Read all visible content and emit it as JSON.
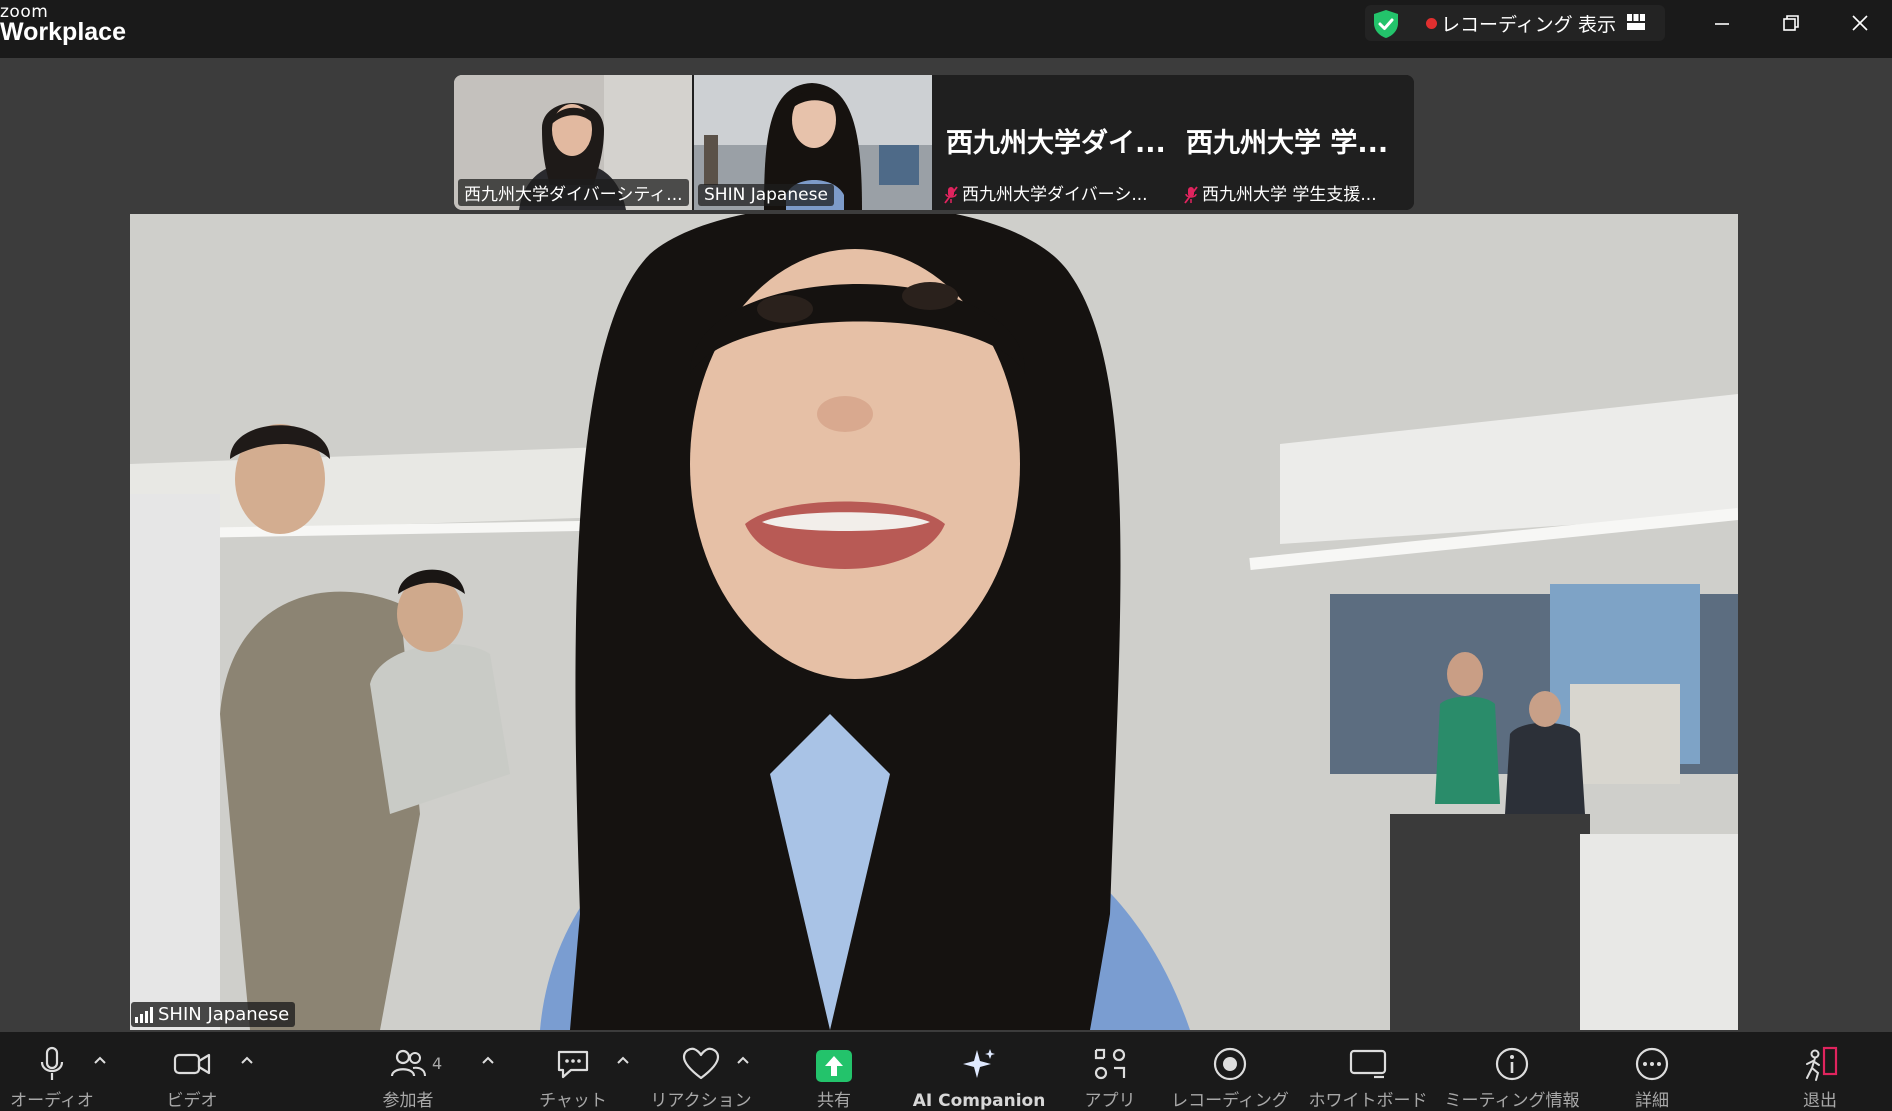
{
  "app": {
    "logo_top": "zoom",
    "logo_bottom": "Workplace"
  },
  "titlebar": {
    "recording_label": "レコーディング",
    "view_label": "表示",
    "colors": {
      "shield": "#23c36b",
      "rec_dot": "#e02f2f"
    }
  },
  "thumbnails": [
    {
      "name": "西九州大学ダイバーシティ...",
      "type": "video",
      "muted": false,
      "active": false
    },
    {
      "name": "SHIN Japanese",
      "type": "video",
      "muted": false,
      "active": true
    },
    {
      "name": "西九州大学ダイバーシ...",
      "big_name": "西九州大学ダイ...",
      "type": "name",
      "muted": true,
      "active": false
    },
    {
      "name": "西九州大学 学生支援...",
      "big_name": "西九州大学 学...",
      "type": "name",
      "muted": true,
      "active": false
    }
  ],
  "main_speaker": {
    "name": "SHIN Japanese"
  },
  "toolbar": {
    "audio": "オーディオ",
    "video": "ビデオ",
    "participants": "参加者",
    "participants_count": "4",
    "chat": "チャット",
    "reactions": "リアクション",
    "share": "共有",
    "ai_companion": "AI Companion",
    "apps": "アプリ",
    "recording": "レコーディング",
    "whiteboard": "ホワイトボード",
    "meeting_info": "ミーティング情報",
    "more": "詳細",
    "leave": "退出",
    "colors": {
      "share": "#23c36b",
      "leave_accent": "#e0245e"
    }
  },
  "icons": [
    "shield-check-icon",
    "record-dot-icon",
    "grid-view-icon",
    "minimize-icon",
    "restore-icon",
    "close-icon",
    "mic-icon",
    "video-camera-icon",
    "participants-icon",
    "chat-icon",
    "heart-icon",
    "share-up-arrow-icon",
    "sparkle-icon",
    "apps-icon",
    "record-icon",
    "whiteboard-icon",
    "info-icon",
    "more-icon",
    "leave-icon",
    "mic-muted-icon",
    "signal-icon",
    "chevron-up-icon"
  ]
}
